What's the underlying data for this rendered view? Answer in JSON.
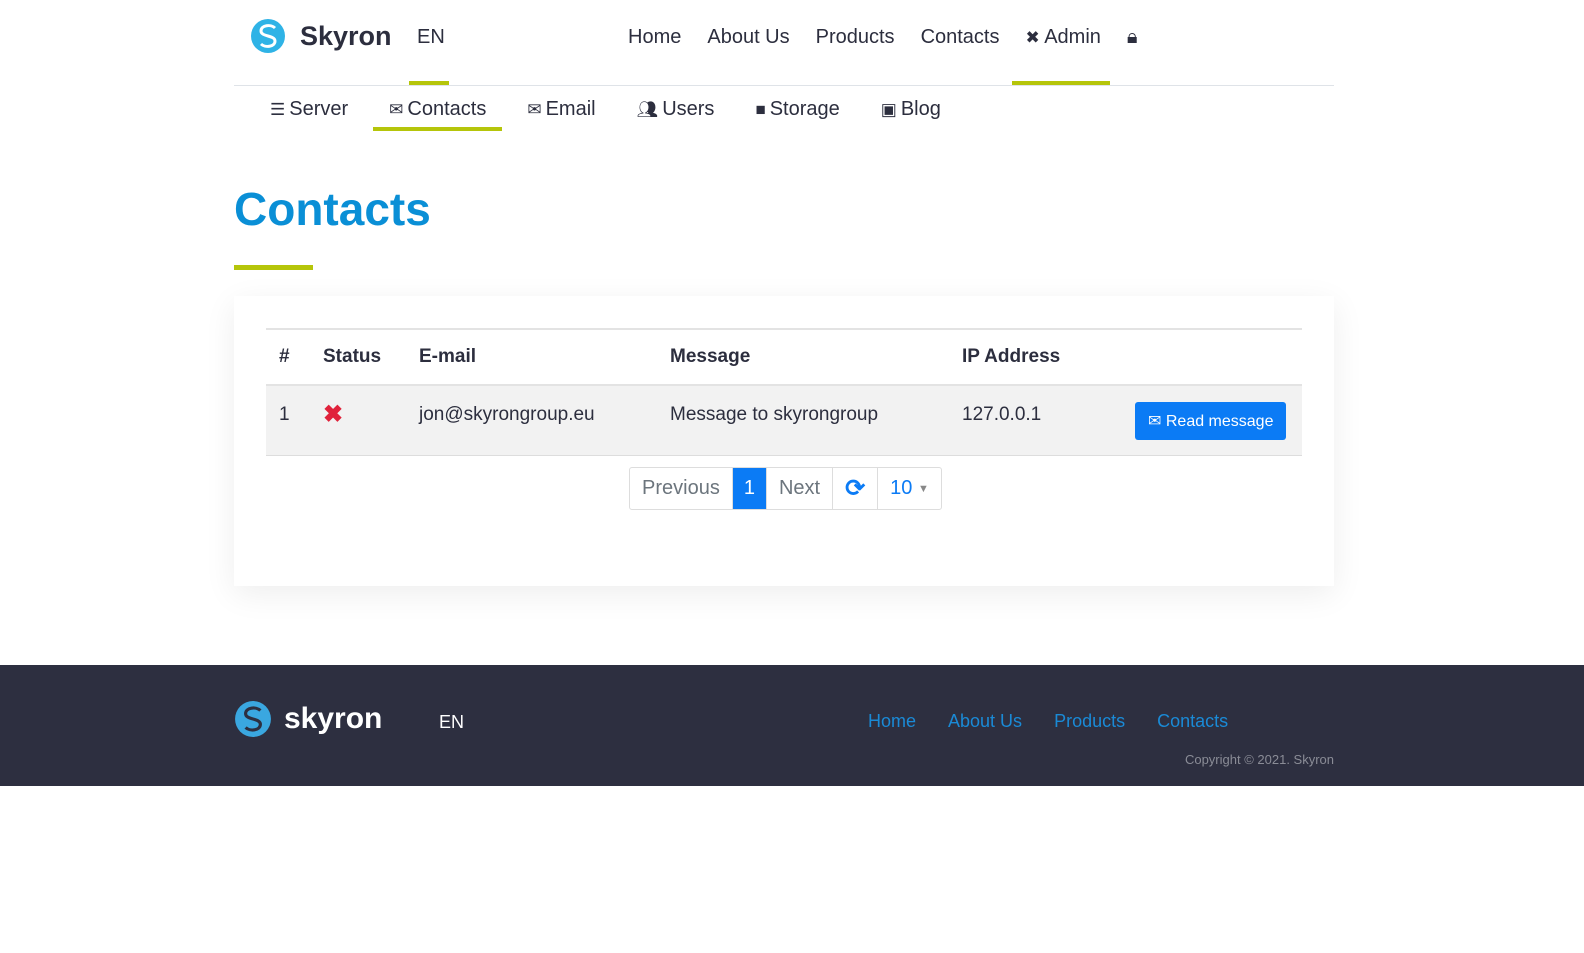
{
  "header": {
    "brand": "Skyron",
    "lang": "EN",
    "nav": [
      "Home",
      "About Us",
      "Products",
      "Contacts",
      "Admin"
    ]
  },
  "subnav": [
    "Server",
    "Contacts",
    "Email",
    "Users",
    "Storage",
    "Blog"
  ],
  "page_title": "Contacts",
  "table": {
    "headers": [
      "#",
      "Status",
      "E-mail",
      "Message",
      "IP Address"
    ],
    "rows": [
      {
        "num": "1",
        "status": "unread",
        "email": "jon@skyrongroup.eu",
        "message": "Message to skyrongroup",
        "ip": "127.0.0.1",
        "action": "Read message"
      }
    ]
  },
  "pager": {
    "previous": "Previous",
    "current": "1",
    "next": "Next",
    "page_size": "10"
  },
  "footer": {
    "brand": "skyron",
    "lang": "EN",
    "nav": [
      "Home",
      "About Us",
      "Products",
      "Contacts"
    ],
    "copyright": "Copyright © 2021. Skyron"
  },
  "colors": {
    "accent": "#b5c50a",
    "title": "#0a8fd6",
    "button": "#0b7bf5",
    "footer_bg": "#2d2f40"
  }
}
